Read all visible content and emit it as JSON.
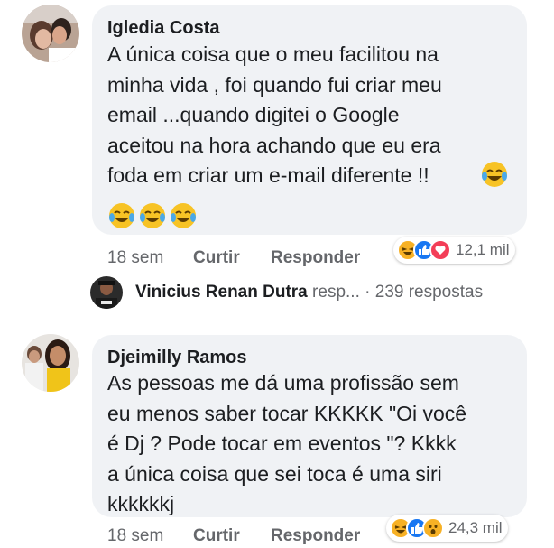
{
  "comments": [
    {
      "author": "Igledia Costa",
      "text": "A única coisa que o meu facilitou na\nminha vida , foi quando fui criar meu\nemail ...quando digitei o Google\naceitou na hora achando que eu era\nfoda em criar um e-mail diferente !!",
      "time": "18 sem",
      "like_label": "Curtir",
      "reply_label": "Responder",
      "reaction_count": "12,1 mil",
      "reactions": [
        "haha-icon",
        "like-icon",
        "love-icon"
      ],
      "reply_preview": {
        "author": "Vinicius Renan Dutra",
        "snippet": "resp...",
        "count": "· 239 respostas"
      }
    },
    {
      "author": "Djeimilly Ramos",
      "text": "As pessoas me dá uma profissão sem\neu menos saber tocar KKKKK \"Oi você\né Dj ? Pode tocar em eventos  \"? Kkkk\na única coisa que sei toca é uma siri\nkkkkkkj",
      "time": "18 sem",
      "like_label": "Curtir",
      "reply_label": "Responder",
      "reaction_count": "24,3 mil",
      "reactions": [
        "haha-icon",
        "like-icon",
        "wow-icon"
      ]
    }
  ],
  "colors": {
    "bubble": "#f0f2f5",
    "like": "#1877f2",
    "love": "#f33e58",
    "emoji": "#f7b125"
  }
}
